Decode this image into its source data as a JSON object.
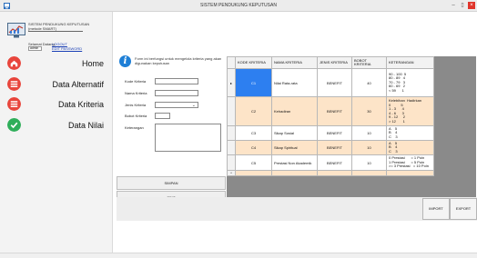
{
  "window": {
    "title": "SISTEM PENDUKUNG KEPUTUSAN",
    "minimize": "–",
    "maximize": "▯",
    "close": "×"
  },
  "brand": {
    "name": "SISTEM PENDUKUNG KEPUTUSAN",
    "subtitle": "(metode SMART)"
  },
  "user": {
    "greeting": "Selamat Datang,",
    "logout": "LOGOUT",
    "username": "admin",
    "edit_password": "EDIT PASSWORD"
  },
  "nav": [
    {
      "label": "Home",
      "icon": "home-icon",
      "color": "#e8453c"
    },
    {
      "label": "Data Alternatif",
      "icon": "list-icon",
      "color": "#e8453c"
    },
    {
      "label": "Data Kriteria",
      "icon": "list-icon",
      "color": "#e8453c"
    },
    {
      "label": "Data Nilai",
      "icon": "check-icon",
      "color": "#2fae5a"
    }
  ],
  "info": {
    "icon": "info-icon",
    "text": "Form ini berfungsi untuk mengelola kriteria yang akan digunakan keputusan"
  },
  "form": {
    "kode_label": "Kode Kriteria",
    "kode_value": "",
    "nama_label": "Nama Kriteria",
    "nama_value": "",
    "jenis_label": "Jenis Kriteria",
    "jenis_value": "",
    "bobot_label": "Bobot Kriteria",
    "bobot_value": "",
    "ket_label": "Keterangan",
    "ket_value": ""
  },
  "buttons": {
    "simpan": "SIMPAN",
    "edit": "EDIT",
    "hapus": "HAPUS",
    "import": "IMPORT",
    "export": "EXPORT"
  },
  "table": {
    "headers": [
      "KODE KRITERIA",
      "NAMA KRITERIA",
      "JENIS KRITERIA",
      "BOBOT KRITERIA",
      "KETERANGAN"
    ],
    "rows": [
      {
        "kode": "C1",
        "nama": "Nilai Rata-rata",
        "jenis": "BENEFIT",
        "bobot": "40",
        "ket": "90 - 100  5\n80 - 89   4\n70 - 79   3\n60 - 69   2\n< 59      1"
      },
      {
        "kode": "C2",
        "nama": "Kehadiran",
        "jenis": "BENEFIT",
        "bobot": "30",
        "ket": "Kelebihan  Hadirkan\n0          5\n1 - 3      4\n4 - 6      3\n9 - 12     2\n> 12       1"
      },
      {
        "kode": "C3",
        "nama": "Sikap Sosial",
        "jenis": "BENEFIT",
        "bobot": "10",
        "ket": "A    5\nB    4\nC    3"
      },
      {
        "kode": "C4",
        "nama": "Sikap Spiritual",
        "jenis": "BENEFIT",
        "bobot": "10",
        "ket": "A    5\nB    4\nC    3"
      },
      {
        "kode": "C5",
        "nama": "Prestasi Non Akademik",
        "jenis": "BENEFIT",
        "bobot": "10",
        "ket": "0 Prestasi      = 1 Poin\n1 Prestasi      = 5 Poin\n>= 3 Prestasi   = 10 Poin"
      }
    ],
    "current_marker": "▸",
    "new_marker": "*"
  },
  "colors": {
    "selected": "#2d7ff0",
    "alt_row": "#fde4c8",
    "danger": "#e8453c",
    "success": "#2fae5a",
    "info": "#1e7fd6"
  }
}
